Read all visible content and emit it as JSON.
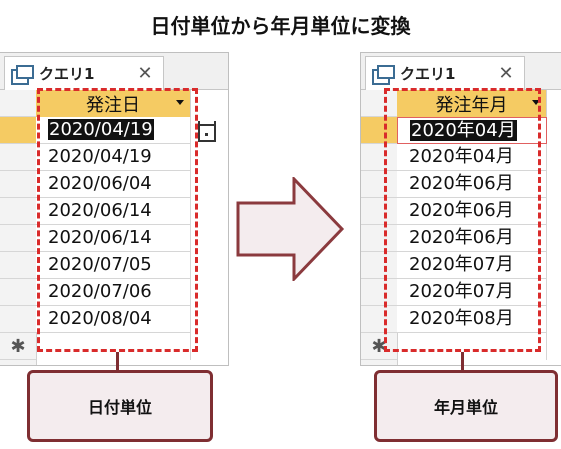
{
  "title": "日付単位から年月単位に変換",
  "left": {
    "tab_label": "クエリ1",
    "column_header": "発注日",
    "rows": [
      "2020/04/19",
      "2020/04/19",
      "2020/06/04",
      "2020/06/14",
      "2020/06/14",
      "2020/07/05",
      "2020/07/06",
      "2020/08/04"
    ],
    "caption": "日付単位"
  },
  "right": {
    "tab_label": "クエリ1",
    "column_header": "発注年月",
    "rows": [
      "2020年04月",
      "2020年04月",
      "2020年06月",
      "2020年06月",
      "2020年06月",
      "2020年07月",
      "2020年07月",
      "2020年08月"
    ],
    "caption": "年月単位"
  },
  "new_row_marker": "✱",
  "close_glyph": "✕",
  "icons": {
    "tab": "query-table-icon",
    "close": "close-icon",
    "calendar": "calendar-icon",
    "arrow": "right-arrow-icon"
  },
  "colors": {
    "header_bg": "#f5cb63",
    "dashed_border": "#d92b2b",
    "caption_border": "#7f2e32",
    "caption_bg": "#f4ecee",
    "arrow_fill": "#f4ecee",
    "arrow_stroke": "#8b3a3e"
  }
}
